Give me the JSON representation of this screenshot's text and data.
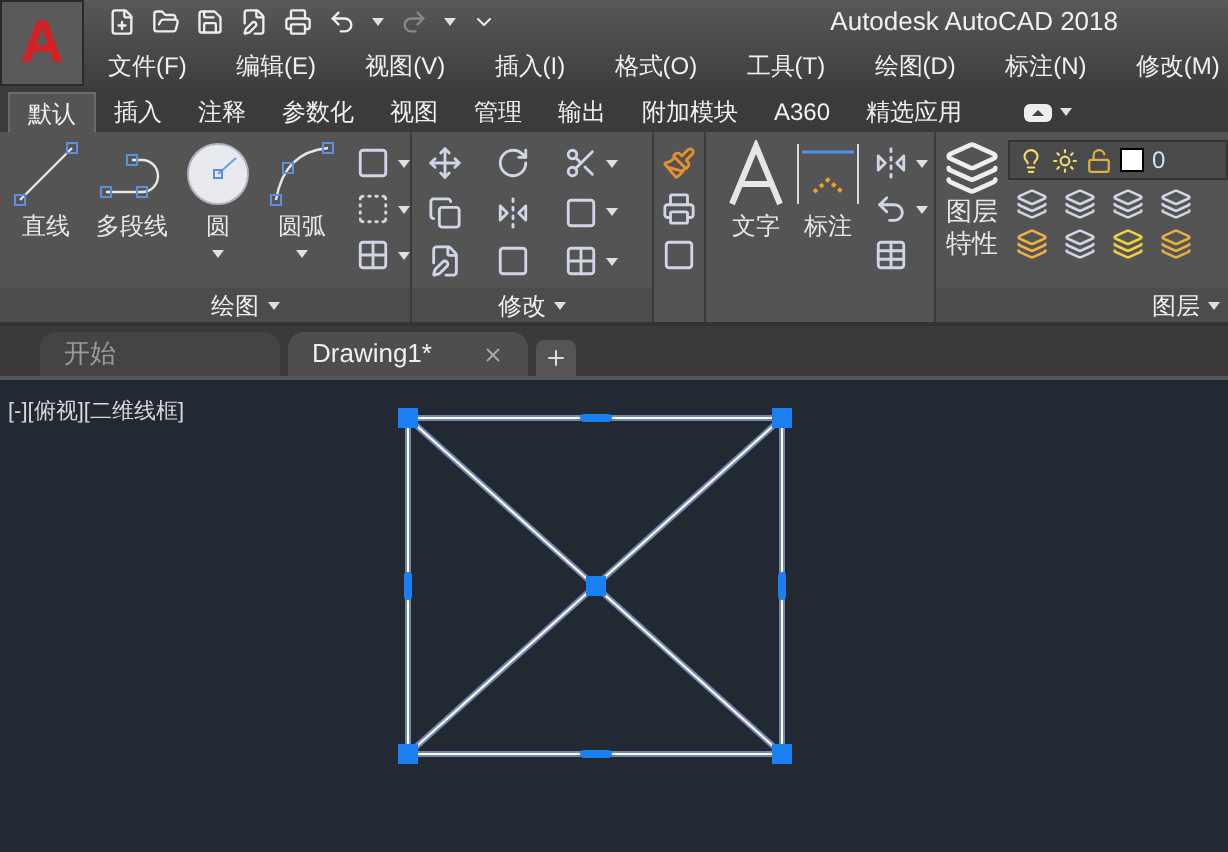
{
  "app": {
    "logo": "A",
    "title": "Autodesk AutoCAD 2018"
  },
  "menu": [
    "文件(F)",
    "编辑(E)",
    "视图(V)",
    "插入(I)",
    "格式(O)",
    "工具(T)",
    "绘图(D)",
    "标注(N)",
    "修改(M)"
  ],
  "ribbon_tabs": [
    {
      "label": "默认",
      "selected": true
    },
    {
      "label": "插入",
      "selected": false
    },
    {
      "label": "注释",
      "selected": false
    },
    {
      "label": "参数化",
      "selected": false
    },
    {
      "label": "视图",
      "selected": false
    },
    {
      "label": "管理",
      "selected": false
    },
    {
      "label": "输出",
      "selected": false
    },
    {
      "label": "附加模块",
      "selected": false
    },
    {
      "label": "A360",
      "selected": false
    },
    {
      "label": "精选应用",
      "selected": false
    }
  ],
  "draw_panel": {
    "title": "绘图",
    "tools": [
      {
        "kind": "line",
        "label": "直线"
      },
      {
        "kind": "polyline",
        "label": "多段线"
      },
      {
        "kind": "circle",
        "label": "圆"
      },
      {
        "kind": "arc",
        "label": "圆弧"
      }
    ]
  },
  "modify_panel": {
    "title": "修改"
  },
  "annotation_panel": {
    "tools": [
      {
        "kind": "text",
        "label": "文字"
      },
      {
        "kind": "dimension",
        "label": "标注"
      }
    ]
  },
  "layers_panel": {
    "title": "图层",
    "tool": "图层特性",
    "current_layer": "0"
  },
  "doc_tabs": [
    {
      "label": "开始",
      "selected": false
    },
    {
      "label": "Drawing1*",
      "selected": true
    }
  ],
  "viewport": {
    "label": "[-][俯视][二维线框]"
  }
}
